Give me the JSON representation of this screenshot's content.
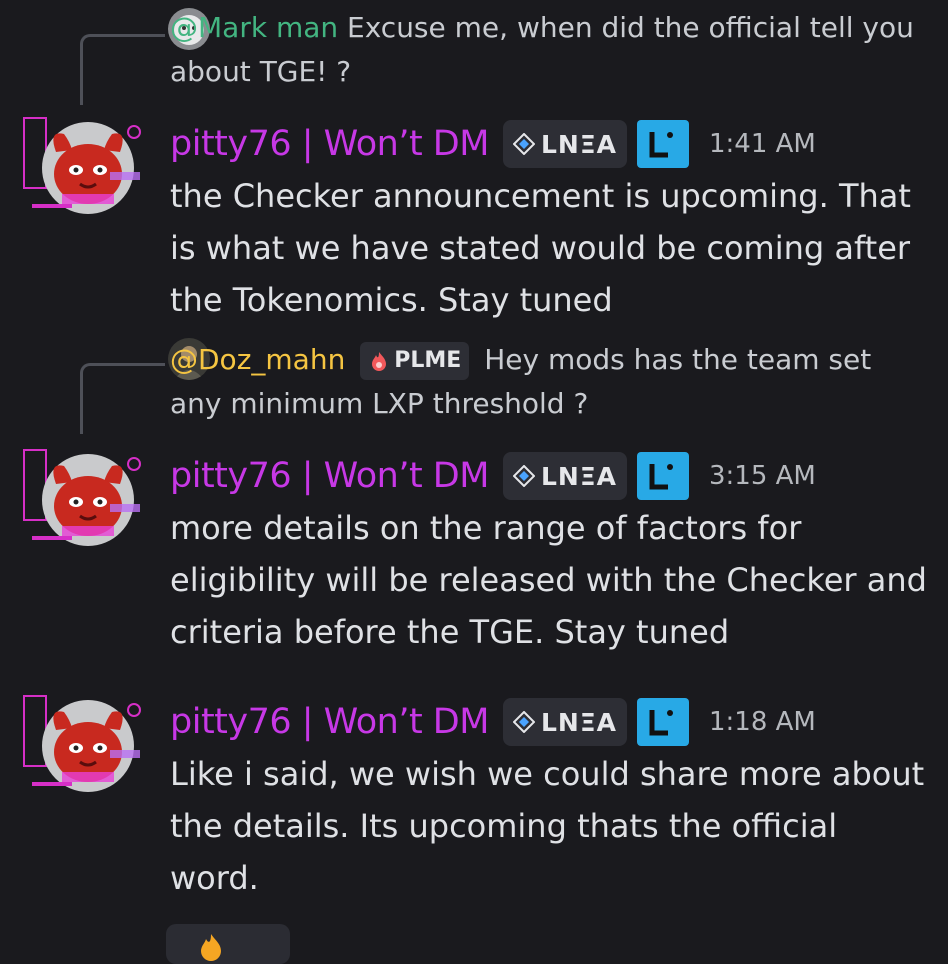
{
  "messages": [
    {
      "reply": {
        "prefix": "@",
        "name": "Mark man",
        "text": " Excuse me, when did the official tell you about TGE! ?"
      },
      "author": "pitty76 | Won’t DM",
      "tag": "LNΞA",
      "timestamp": "1:41 AM",
      "text": "the Checker announcement is upcoming. That is what we have stated would be coming after the Tokenomics. Stay tuned"
    },
    {
      "reply": {
        "name": "@Doz_mahn",
        "tag": "PLME",
        "text": "Hey mods has the team set any minimum LXP threshold ?"
      },
      "author": "pitty76 | Won’t DM",
      "tag": "LNΞA",
      "timestamp": "3:15 AM",
      "text": "more details on the range of factors for eligibility will be released with the Checker and criteria before the TGE. Stay tuned"
    },
    {
      "author": "pitty76 | Won’t DM",
      "tag": "LNΞA",
      "timestamp": "1:18 AM",
      "text": "Like i said, we wish we could share more about the details. Its upcoming thats the official word."
    }
  ],
  "icons": {
    "lbadge": "linea-l-badge-icon",
    "diamond": "diamond-icon",
    "fire": "fire-icon"
  },
  "colors": {
    "author": "#c738e6",
    "mention_green": "#43b581",
    "mention_yellow": "#f5c542",
    "lbadge": "#28a9e6"
  }
}
